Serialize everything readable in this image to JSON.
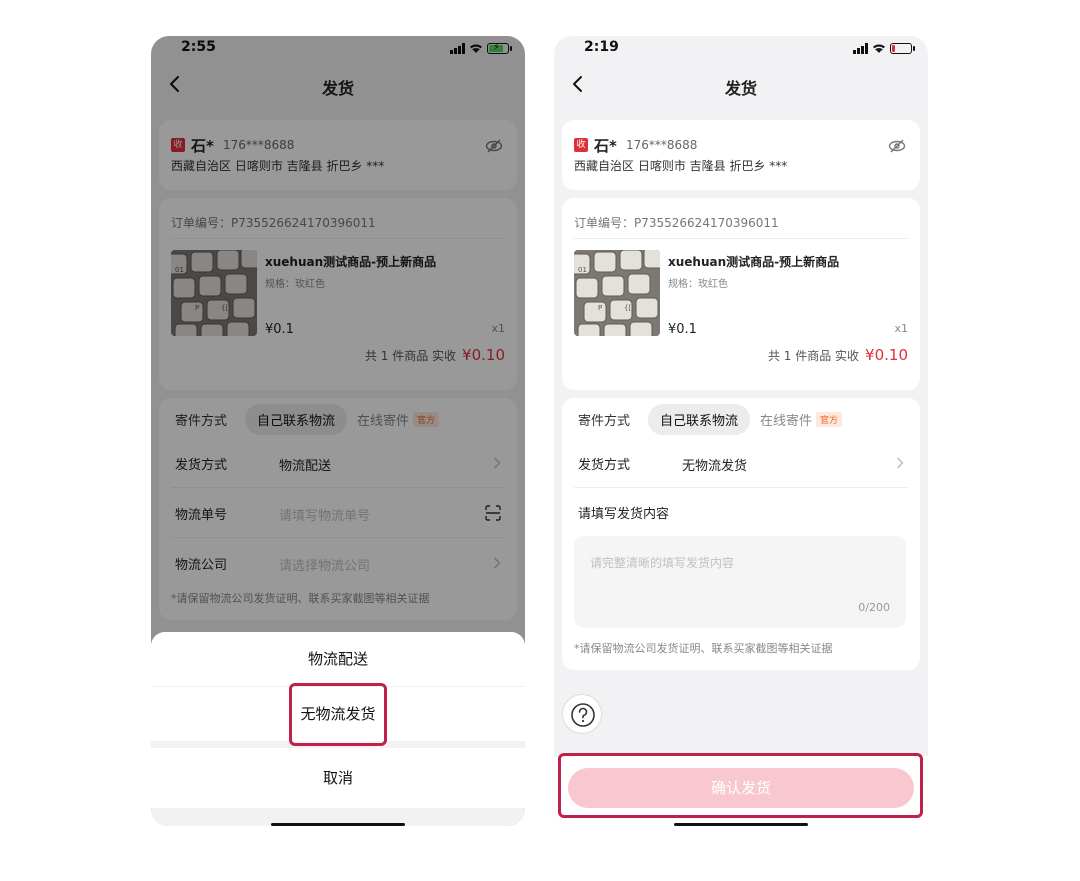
{
  "left_screen": {
    "status": {
      "time": "2:55"
    },
    "nav": {
      "title": "发货"
    },
    "address": {
      "tag": "收",
      "name": "石*",
      "phone": "176***8688",
      "detail": "西藏自治区 日喀则市 吉隆县 折巴乡 ***"
    },
    "order": {
      "number": "订单编号：P735526624170396011",
      "product_name": "xuehuan测试商品-预上新商品",
      "spec": "规格：玫红色",
      "price": "¥0.1",
      "qty": "x1",
      "total_prefix": "共 1 件商品  实收",
      "total_amount": "¥0.10"
    },
    "shipping": {
      "tab_label": "寄件方式",
      "tab_self": "自己联系物流",
      "tab_online": "在线寄件",
      "tab_online_tag": "官方",
      "method_label": "发货方式",
      "method_value": "物流配送",
      "tracking_label": "物流单号",
      "tracking_placeholder": "请填写物流单号",
      "company_label": "物流公司",
      "company_placeholder": "请选择物流公司",
      "note": "*请保留物流公司发货证明、联系买家截图等相关证据"
    },
    "sheet": {
      "option_1": "物流配送",
      "option_2": "无物流发货",
      "cancel": "取消"
    }
  },
  "right_screen": {
    "status": {
      "time": "2:19"
    },
    "nav": {
      "title": "发货"
    },
    "address": {
      "tag": "收",
      "name": "石*",
      "phone": "176***8688",
      "detail": "西藏自治区 日喀则市 吉隆县 折巴乡 ***"
    },
    "order": {
      "number": "订单编号：P735526624170396011",
      "product_name": "xuehuan测试商品-预上新商品",
      "spec": "规格：玫红色",
      "price": "¥0.1",
      "qty": "x1",
      "total_prefix": "共 1 件商品  实收",
      "total_amount": "¥0.10"
    },
    "shipping": {
      "tab_label": "寄件方式",
      "tab_self": "自己联系物流",
      "tab_online": "在线寄件",
      "tab_online_tag": "官方",
      "method_label": "发货方式",
      "method_value": "无物流发货",
      "content_label": "请填写发货内容",
      "content_placeholder": "请完整清晰的填写发货内容",
      "content_count": "0/200",
      "note": "*请保留物流公司发货证明、联系买家截图等相关证据"
    },
    "help_icon": "question-circle-icon",
    "confirm_button": "确认发货"
  },
  "colors": {
    "accent_red": "#e02e3a",
    "highlight": "#c0214a",
    "confirm_disabled": "#f8c7d0",
    "official_tag": "#e8692a"
  }
}
